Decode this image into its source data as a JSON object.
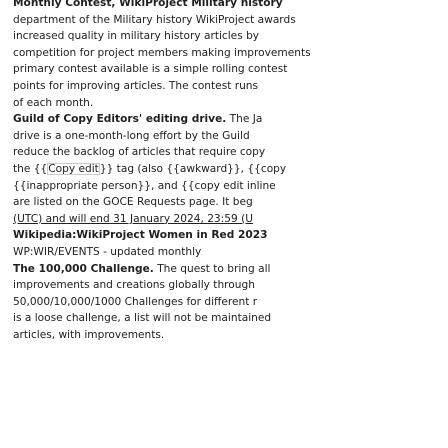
{
  "items": [
    {
      "lines": [
        [
          {
            "t": "Monthly Contest, WikiProject Military history",
            "b": true
          }
        ],
        [
          {
            "t": "department of the Military history WikiProject awards",
            "b": false
          }
        ],
        [
          {
            "t": "increased quality in military history articles by",
            "b": false
          }
        ],
        [
          {
            "t": "competition for project members making improvements",
            "b": false
          }
        ],
        [
          {
            "t": "primary contest available is a simple rolling contest",
            "b": false
          }
        ],
        [
          {
            "t": "points for improving articles. The contest runs",
            "b": false
          }
        ],
        [
          {
            "t": "of each month.",
            "b": false
          }
        ]
      ]
    },
    {
      "lines": [
        [
          {
            "t": "Guild of Copy Editors' editing drive.",
            "b": true
          },
          {
            "t": " The Ja",
            "b": false
          }
        ],
        [
          {
            "t": "drive is a one-month-long effort by the Guild",
            "b": false
          }
        ],
        [
          {
            "t": "reduce the backlog of articles that require copy",
            "b": false
          }
        ],
        [
          {
            "t": "the {{",
            "b": false
          },
          {
            "t": "Copy edit",
            "b": false,
            "box": true
          },
          {
            "t": "}} tag (also {{awkward}}, {{copy",
            "b": false
          }
        ],
        [
          {
            "t": "{{inappropriate person}}, and {{copy edit inline",
            "b": false
          }
        ],
        [
          {
            "t": "are listed on the GOCE Requests page. It beg",
            "b": false
          }
        ],
        [
          {
            "t": "(UTC) and will end 31 January 2024, 23:59 (U",
            "b": false,
            "u": true
          }
        ]
      ]
    },
    {
      "lines": [
        [
          {
            "t": "Wikipedia:WikiProject Women in Red 2023",
            "b": true
          }
        ],
        [
          {
            "t": "WP:WIR/EVENTS - updated monthly",
            "b": false
          }
        ]
      ]
    },
    {
      "lines": [
        [
          {
            "t": "The 100,000 Challenge.",
            "b": true
          },
          {
            "t": " The quest to bring all",
            "b": false
          }
        ],
        [
          {
            "t": "improvements and creations globally through",
            "b": false
          }
        ],
        [
          {
            "t": "50,000/10,000/1000 Challenges for different r",
            "b": false
          }
        ],
        [
          {
            "t": "is a loose challenge, a list will not be maintained",
            "b": false
          }
        ],
        [
          {
            "t": "articles, with improvements.",
            "b": false
          }
        ]
      ]
    }
  ]
}
